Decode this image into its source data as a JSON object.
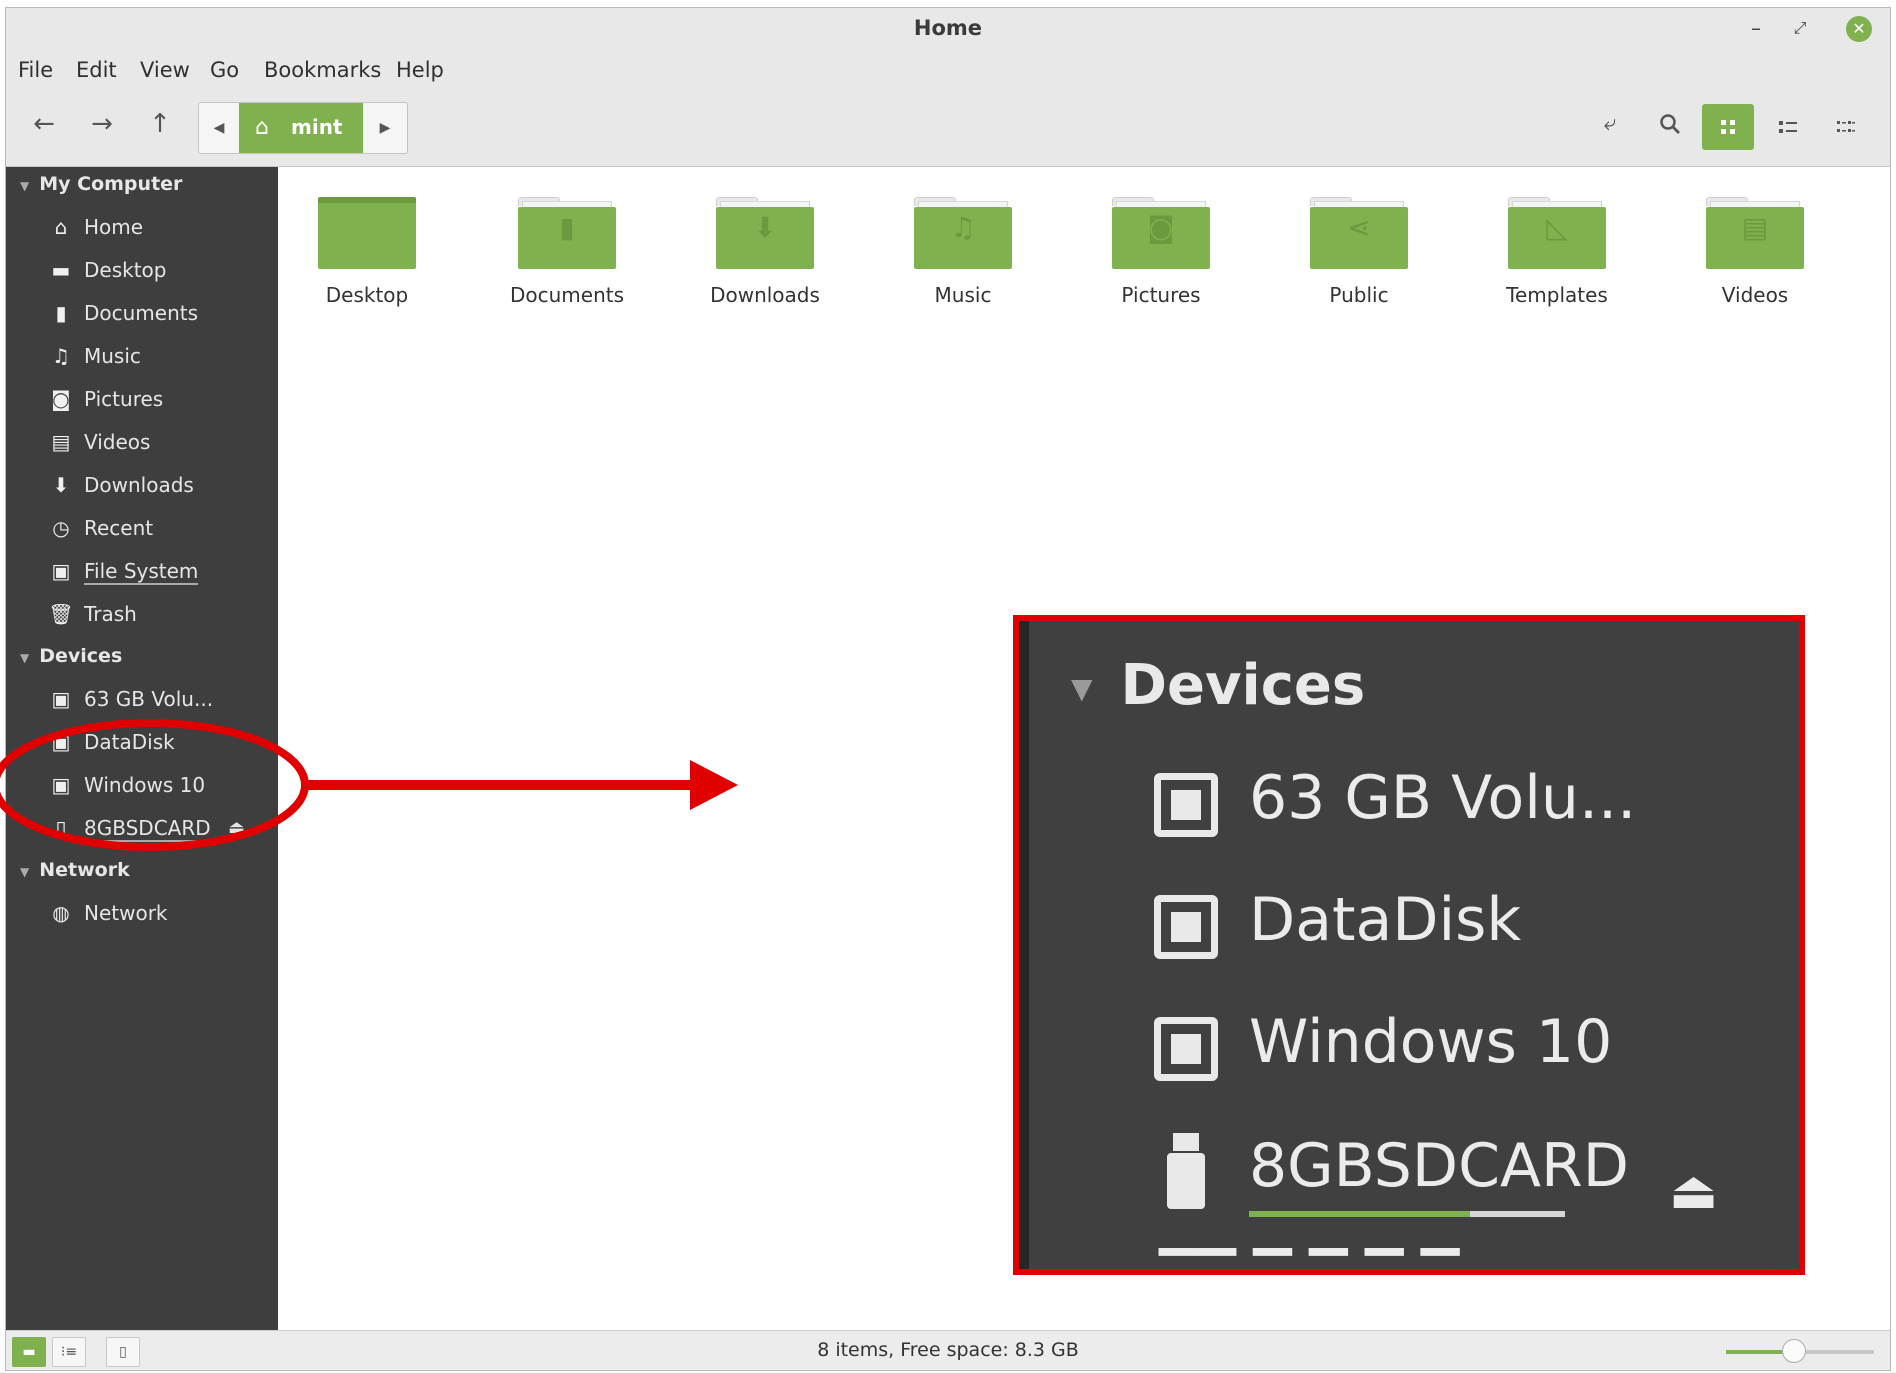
{
  "window": {
    "title": "Home",
    "controls": {
      "minimize": "–",
      "maximize": "⤢",
      "close": "✕"
    }
  },
  "menubar": [
    "File",
    "Edit",
    "View",
    "Go",
    "Bookmarks",
    "Help"
  ],
  "toolbar": {
    "back_icon": "arrow-left-icon",
    "forward_icon": "arrow-right-icon",
    "up_icon": "arrow-up-icon",
    "path_crumb": "mint",
    "toggle_location_icon": "location-toggle-icon",
    "search_icon": "search-icon",
    "active_view": "icon"
  },
  "sidebar": {
    "sections": [
      {
        "title": "My Computer",
        "items": [
          "Home",
          "Desktop",
          "Documents",
          "Music",
          "Pictures",
          "Videos",
          "Downloads",
          "Recent",
          "File System",
          "Trash"
        ]
      },
      {
        "title": "Devices",
        "items": [
          "63 GB Volu...",
          "DataDisk",
          "Windows 10",
          "8GBSDCARD"
        ]
      },
      {
        "title": "Network",
        "items": [
          "Network"
        ]
      }
    ]
  },
  "folders": [
    "Desktop",
    "Documents",
    "Downloads",
    "Music",
    "Pictures",
    "Public",
    "Templates",
    "Videos"
  ],
  "zoom": {
    "heading": "Devices",
    "items": [
      "63 GB Volu...",
      "DataDisk",
      "Windows 10",
      "8GBSDCARD"
    ],
    "sdcard_usage_fraction": 0.7
  },
  "status": {
    "text": "8 items, Free space: 8.3 GB",
    "zoom_level_fraction": 0.45
  },
  "colors": {
    "accent": "#7fb24e",
    "sidebar_bg": "#3e3e3e",
    "annotation": "#e00000"
  }
}
